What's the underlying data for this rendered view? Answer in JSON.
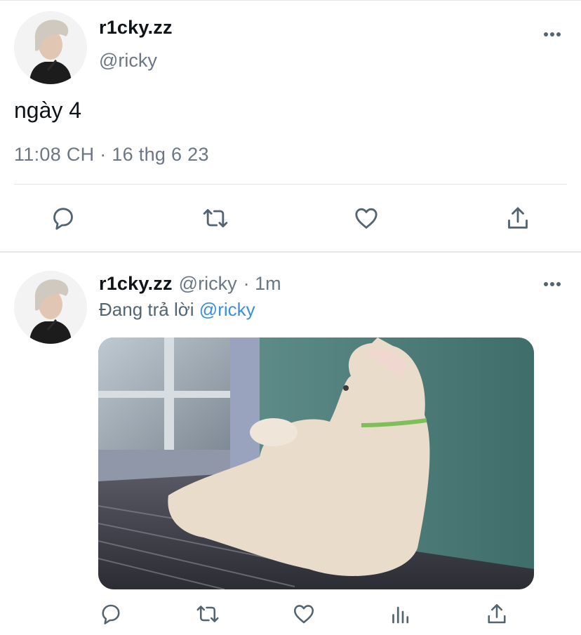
{
  "main_tweet": {
    "display_name": "r1cky.zz",
    "handle": "@ricky",
    "text": "ngày 4",
    "meta": "11:08 CH · 16 thg 6 23",
    "avatar_icon": "person-avatar",
    "actions": [
      "reply-icon",
      "retweet-icon",
      "like-icon",
      "share-icon"
    ]
  },
  "reply_tweet": {
    "display_name": "r1cky.zz",
    "handle": "@ricky",
    "time": "· 1m",
    "replying_label": "Đang trả lời",
    "replying_to": "@ricky",
    "avatar_icon": "person-avatar",
    "media_description_icon": "photo",
    "actions": [
      "reply-icon",
      "retweet-icon",
      "like-icon",
      "analytics-icon",
      "share-icon"
    ]
  },
  "colors": {
    "text": "#0f1419",
    "secondary": "#6b7785",
    "link": "#3b8fd9",
    "divider": "#e1e4e8",
    "icon": "#536471"
  }
}
